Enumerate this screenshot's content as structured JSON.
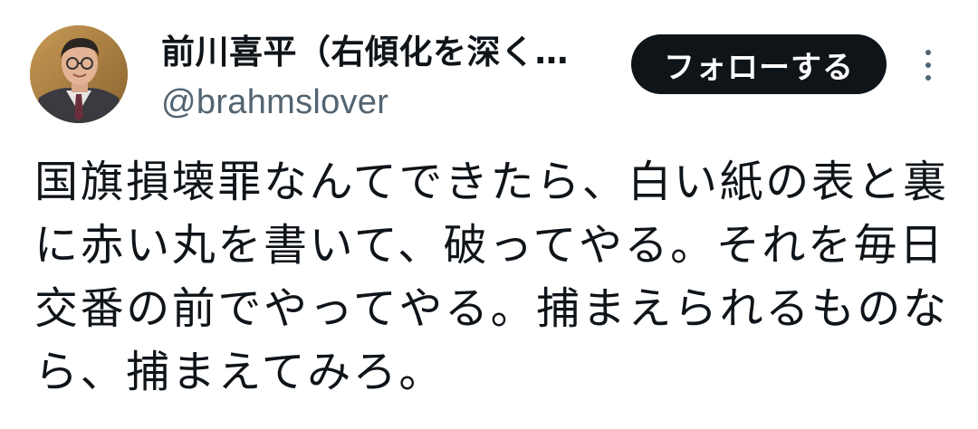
{
  "author": {
    "display_name": "前川喜平（右傾化を深く…",
    "handle": "@brahmslover"
  },
  "actions": {
    "follow_label": "フォローする",
    "more_icon": "more-vertical-icon"
  },
  "tweet": {
    "lines": [
      "国旗損壊罪なんてできたら、白い紙の表と裏",
      "に赤い丸を書いて、破ってやる。それを毎日",
      "交番の前でやってやる。捕まえられるものな",
      "ら、捕まえてみろ。"
    ]
  },
  "colors": {
    "text": "#0f1419",
    "secondary": "#536471",
    "button_bg": "#0f1419",
    "button_text": "#ffffff",
    "background": "#ffffff"
  }
}
